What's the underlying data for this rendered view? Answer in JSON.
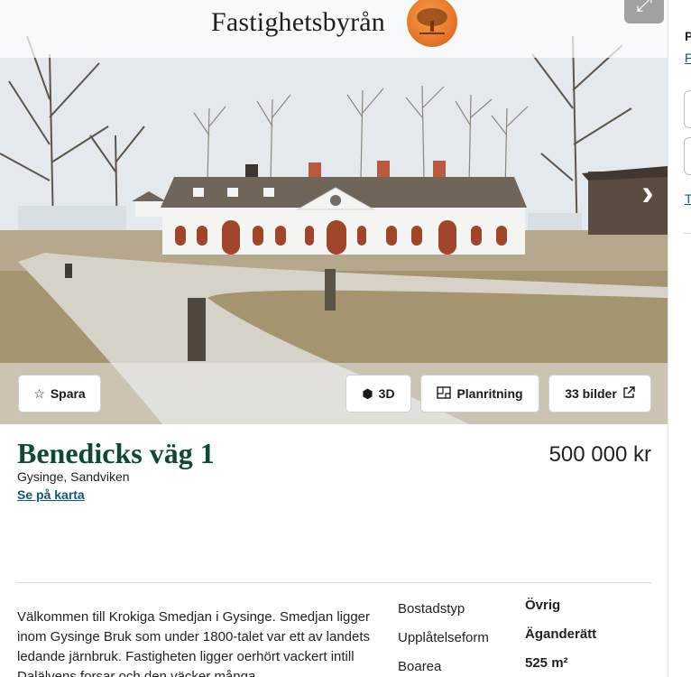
{
  "brand": {
    "name": "Fastighetsbyrån",
    "logo_icon": "oak-tree-icon"
  },
  "gallery": {
    "expand_icon": "expand-icon",
    "next_icon": "chevron-right-icon",
    "save_label": "Spara",
    "save_icon": "star-outline-icon",
    "threed_label": "3D",
    "threed_icon": "cube-icon",
    "floorplan_label": "Planritning",
    "floorplan_icon": "floorplan-icon",
    "photos_label": "33 bilder",
    "photos_icon": "external-link-icon"
  },
  "listing": {
    "title": "Benedicks väg 1",
    "location": "Gysinge, Sandviken",
    "map_link": "Se på karta",
    "price": "500 000 kr",
    "description": "Välkommen till Krokiga Smedjan i Gysinge. Smedjan ligger inom Gysinge Bruk som under 1800-talet var ett av landets ledande järnbruk. Fastigheten ligger oerhört vackert intill Dalälvens forsar och den väcker många"
  },
  "facts": [
    {
      "label": "Bostadstyp",
      "value": "Övrig"
    },
    {
      "label": "Upplåtelseform",
      "value": "Äganderätt"
    },
    {
      "label": "Boarea",
      "value": "525 m²"
    }
  ],
  "sidebar": {
    "heading_fragment": "P",
    "link_fragment": "Fa",
    "link2_fragment": "T"
  },
  "colors": {
    "title_green": "#0d4a2f",
    "link_blue": "#0d5a7a",
    "logo_orange": "#e8762a"
  }
}
